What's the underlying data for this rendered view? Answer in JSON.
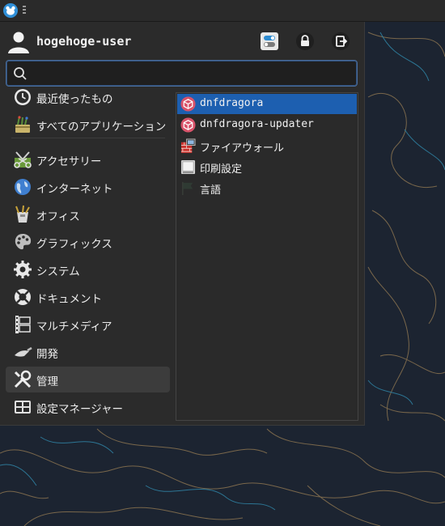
{
  "user": {
    "name": "hogehoge-user"
  },
  "search": {
    "value": "",
    "placeholder": ""
  },
  "categories": [
    {
      "label": "最近使ったもの",
      "icon": "clock-icon"
    },
    {
      "label": "すべてのアプリケーション",
      "icon": "all-apps-icon"
    },
    {
      "label": "アクセサリー",
      "icon": "accessories-icon"
    },
    {
      "label": "インターネット",
      "icon": "globe-icon"
    },
    {
      "label": "オフィス",
      "icon": "office-icon"
    },
    {
      "label": "グラフィックス",
      "icon": "palette-icon"
    },
    {
      "label": "システム",
      "icon": "gear-icon"
    },
    {
      "label": "ドキュメント",
      "icon": "help-lifebuoy-icon"
    },
    {
      "label": "マルチメディア",
      "icon": "film-icon"
    },
    {
      "label": "開発",
      "icon": "trowel-icon"
    },
    {
      "label": "管理",
      "icon": "tools-icon"
    },
    {
      "label": "設定マネージャー",
      "icon": "settings-manager-icon"
    }
  ],
  "selected_category": "管理",
  "apps": [
    {
      "label": "dnfdragora",
      "icon": "package-icon"
    },
    {
      "label": "dnfdragora-updater",
      "icon": "package-icon"
    },
    {
      "label": "ファイアウォール",
      "icon": "firewall-icon"
    },
    {
      "label": "印刷設定",
      "icon": "printer-icon"
    },
    {
      "label": "言語",
      "icon": "flag-icon"
    }
  ],
  "selected_app": "dnfdragora",
  "colors": {
    "selection": "#1d5fb0",
    "menu_bg": "#2b2b2b",
    "wallpaper": "#1c2431"
  }
}
